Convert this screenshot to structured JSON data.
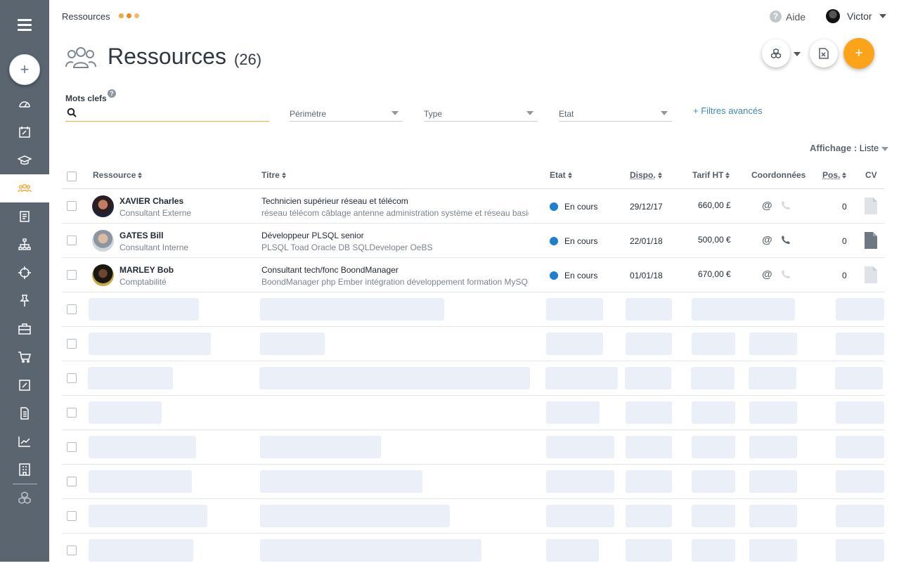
{
  "breadcrumb": "Ressources",
  "header": {
    "help_label": "Aide",
    "user_name": "Victor"
  },
  "page": {
    "title": "Ressources",
    "count": "(26)"
  },
  "filters": {
    "keywords_label": "Mots clefs",
    "keywords_value": "",
    "perimetre": "Périmètre",
    "type": "Type",
    "etat": "Etat",
    "advanced": "+ Filtres avancés"
  },
  "display": {
    "label": "Affichage :",
    "value": "Liste"
  },
  "columns": {
    "ressource": "Ressource",
    "titre": "Titre",
    "etat": "Etat",
    "dispo": "Dispo.",
    "tarif": "Tarif HT",
    "coordonnees": "Coordonnées",
    "pos": "Pos.",
    "cv": "CV"
  },
  "rows": [
    {
      "name": "XAVIER Charles",
      "role": "Consultant Externe",
      "title": "Technicien supérieur réseau et télécom",
      "skills": "réseau télécom câblage antenne administration système et réseau basique",
      "state": "En cours",
      "dispo": "29/12/17",
      "tarif": "660,00 £",
      "pos": "0"
    },
    {
      "name": "GATES Bill",
      "role": "Consultant Interne",
      "title": "Développeur PLSQL senior",
      "skills": "PLSQL Toad Oracle DB SQLDeveloper OeBS",
      "state": "En cours",
      "dispo": "22/01/18",
      "tarif": "500,00 €",
      "pos": "0"
    },
    {
      "name": "MARLEY Bob",
      "role": "Comptabilité",
      "title": "Consultant tech/fonc BoondManager",
      "skills": "BoondManager php Ember intégration développement formation MySQL",
      "state": "En cours",
      "dispo": "01/01/18",
      "tarif": "670,00 €",
      "pos": "0"
    }
  ],
  "colors": {
    "accent": "#fca419",
    "sidebar": "#5a6570",
    "state_dot": "#1e7fd1",
    "skeleton": "#eaeff8"
  }
}
